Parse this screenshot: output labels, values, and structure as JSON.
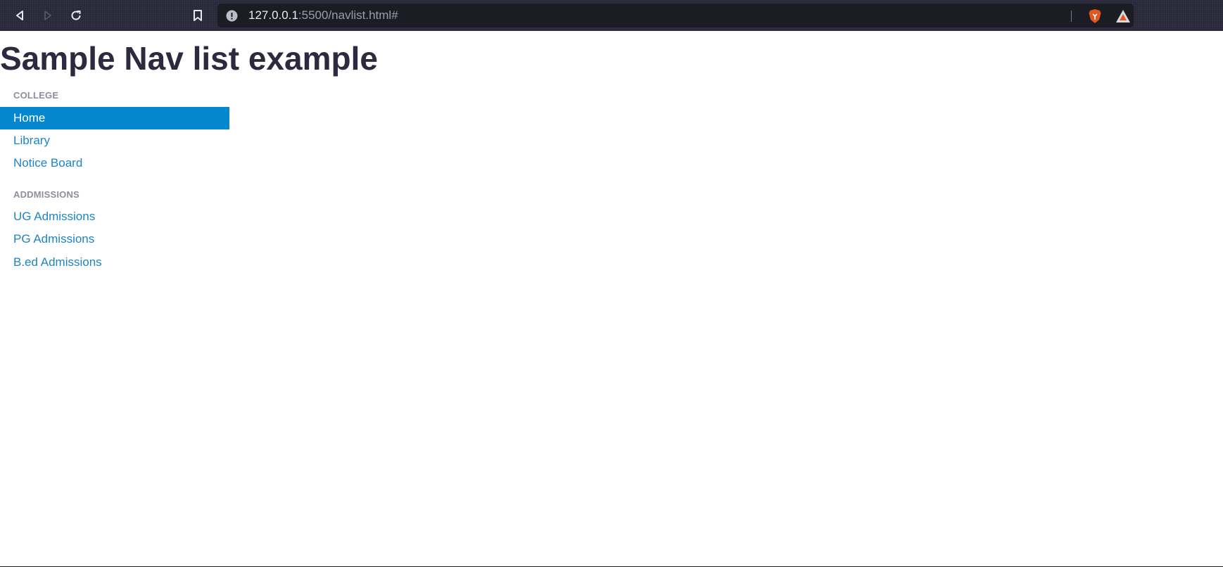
{
  "browser": {
    "url_host": "127.0.0.1",
    "url_rest": ":5500/navlist.html#",
    "icons": [
      "back-icon",
      "forward-icon",
      "reload-icon",
      "bookmark-icon",
      "site-info-icon",
      "brave-shields-icon",
      "brave-rewards-icon"
    ]
  },
  "page": {
    "title": "Sample Nav list example"
  },
  "nav": {
    "college": {
      "header": "COLLEGE",
      "items": [
        {
          "label": "Home",
          "active": true
        },
        {
          "label": "Library",
          "active": false
        },
        {
          "label": "Notice Board",
          "active": false
        }
      ]
    },
    "admissions": {
      "header": "ADDMISSIONS",
      "items": [
        {
          "label": "UG Admissions",
          "active": false
        },
        {
          "label": "PG Admissions",
          "active": false
        },
        {
          "label": "B.ed Admissions",
          "active": false
        }
      ]
    }
  },
  "colors": {
    "toolbar_bg": "#29283a",
    "active_bg": "#0487cd",
    "link": "#1e84c6",
    "title": "#2b2a3e",
    "header": "#8e8e9c"
  }
}
